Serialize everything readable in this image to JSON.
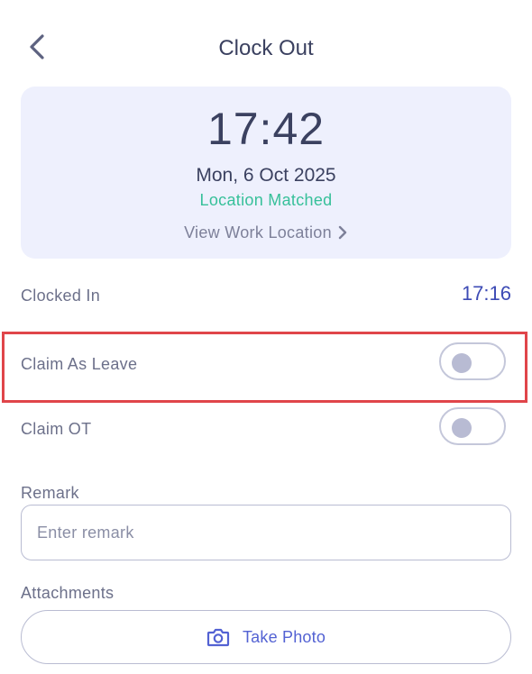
{
  "header": {
    "title": "Clock Out",
    "back_icon": "chevron-left-icon"
  },
  "time_card": {
    "time": "17:42",
    "date": "Mon, 6 Oct 2025",
    "location_status": "Location Matched",
    "view_location_label": "View Work Location",
    "view_location_icon": "chevron-right-icon"
  },
  "clocked_in": {
    "label": "Clocked In",
    "value": "17:16"
  },
  "claim_as_leave": {
    "label": "Claim As Leave",
    "enabled": false
  },
  "claim_ot": {
    "label": "Claim OT",
    "enabled": false
  },
  "remark": {
    "label": "Remark",
    "placeholder": "Enter remark",
    "value": ""
  },
  "attachments": {
    "label": "Attachments",
    "button_label": "Take Photo",
    "button_icon": "camera-icon"
  },
  "colors": {
    "accent": "#5362d3",
    "success": "#37c09a",
    "card_background": "#eef0fd",
    "highlight": "#e0454a"
  }
}
